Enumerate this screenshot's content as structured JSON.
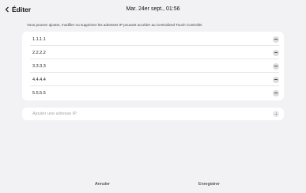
{
  "header": {
    "back_label": "Éditer",
    "datetime": "Mar. 24er sept., 01:56"
  },
  "info_text": "Vous pouvez ajouter, modifier ou supprimer les adresses IP pouvant accéder au Centralized Touch Controller",
  "ip_list": [
    {
      "ip": "1.1.1.1"
    },
    {
      "ip": "2.2.2.2"
    },
    {
      "ip": "3.3.3.3"
    },
    {
      "ip": "4.4.4.4"
    },
    {
      "ip": "5.5.5.5"
    }
  ],
  "add_field": {
    "placeholder": "Ajouter une adresse IP"
  },
  "footer": {
    "cancel_label": "Annuler",
    "save_label": "Enregistrer"
  },
  "colors": {
    "background": "#f2f2f4",
    "card": "#ffffff",
    "remove_button": "#dcdcdc",
    "placeholder_text": "#a6a6a6"
  }
}
